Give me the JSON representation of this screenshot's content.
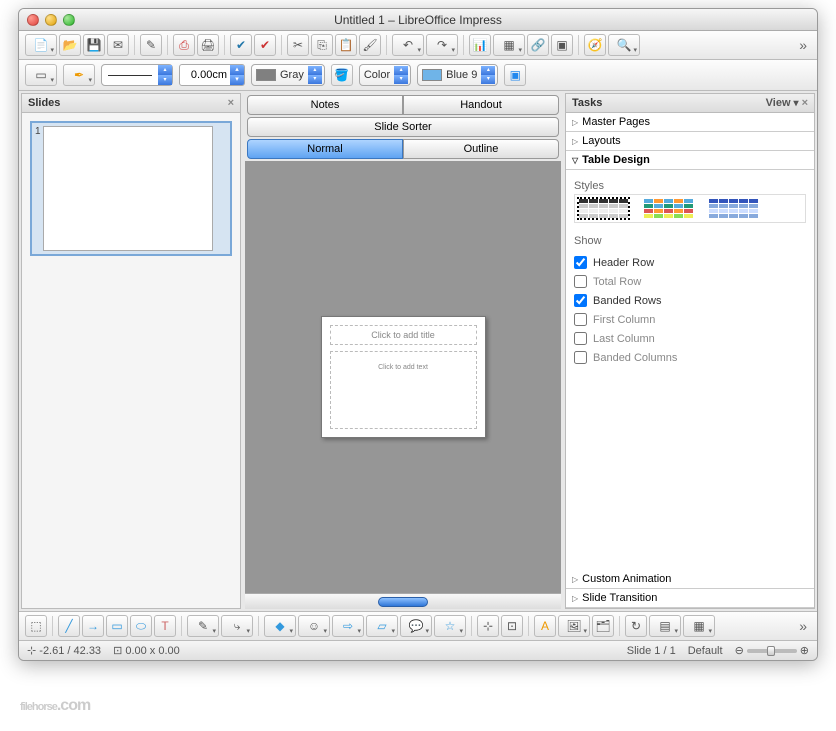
{
  "window": {
    "title": "Untitled 1 – LibreOffice Impress"
  },
  "toolbar2": {
    "width_value": "0.00cm",
    "line_color": {
      "swatch": "#808080",
      "label": "Gray"
    },
    "fill_type": "Color",
    "fill_color": {
      "swatch": "#6fb4e8",
      "label": "Blue 9"
    }
  },
  "slides_panel": {
    "title": "Slides",
    "thumbs": [
      {
        "num": "1"
      }
    ]
  },
  "views": {
    "row1": [
      "Notes",
      "Handout"
    ],
    "row2": [
      "Slide Sorter"
    ],
    "row3": [
      "Normal",
      "Outline"
    ],
    "active": "Normal"
  },
  "slide_placeholders": {
    "title": "Click to add title",
    "content": "Click to add text"
  },
  "tasks": {
    "title": "Tasks",
    "view_label": "View",
    "sections": [
      {
        "label": "Master Pages",
        "expanded": false
      },
      {
        "label": "Layouts",
        "expanded": false
      },
      {
        "label": "Table Design",
        "expanded": true
      },
      {
        "label": "Custom Animation",
        "expanded": false
      },
      {
        "label": "Slide Transition",
        "expanded": false
      }
    ],
    "table_design": {
      "styles_label": "Styles",
      "show_label": "Show",
      "options": [
        {
          "label": "Header Row",
          "checked": true
        },
        {
          "label": "Total Row",
          "checked": false
        },
        {
          "label": "Banded Rows",
          "checked": true
        },
        {
          "label": "First Column",
          "checked": false
        },
        {
          "label": "Last Column",
          "checked": false
        },
        {
          "label": "Banded Columns",
          "checked": false
        }
      ]
    }
  },
  "status": {
    "coords": "-2.61 / 42.33",
    "size": "0.00 x 0.00",
    "slide": "Slide 1 / 1",
    "layout": "Default"
  },
  "watermark": "filehorse",
  "watermark_suffix": ".com"
}
